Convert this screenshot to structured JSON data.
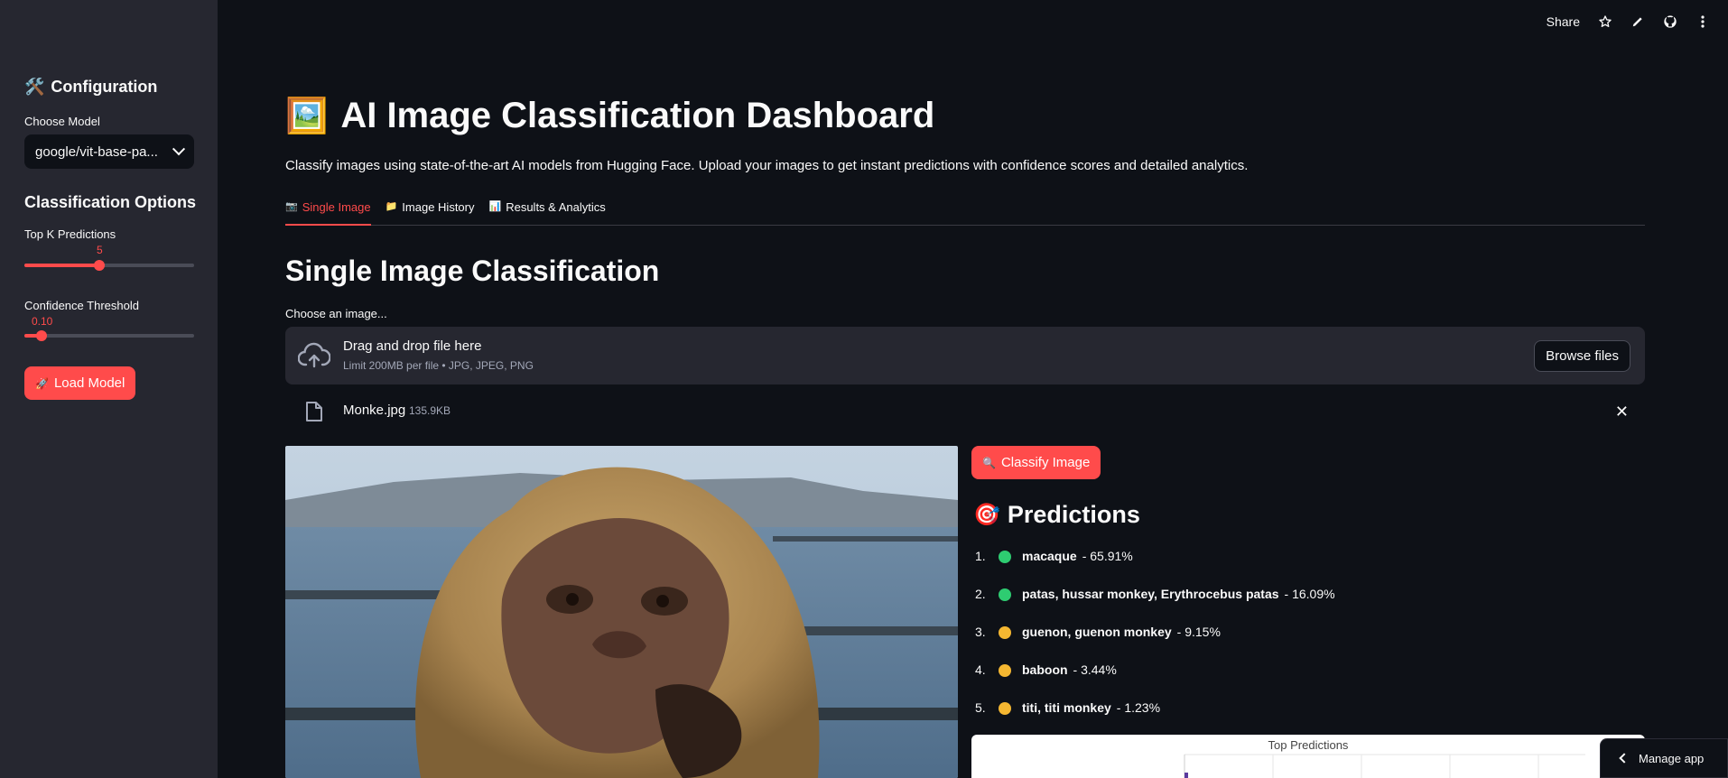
{
  "sidebar": {
    "config_title": "Configuration",
    "config_icon": "🛠️",
    "model_label": "Choose Model",
    "model_value": "google/vit-base-pa...",
    "options_title": "Classification Options",
    "topk_label": "Top K Predictions",
    "topk_value": "5",
    "topk_fraction": 0.44,
    "threshold_label": "Confidence Threshold",
    "threshold_value": "0.10",
    "threshold_fraction": 0.1,
    "load_button": "Load Model",
    "load_icon": "🚀"
  },
  "toolbar": {
    "share": "Share",
    "icons": [
      "star-icon",
      "edit-icon",
      "github-icon",
      "more-icon"
    ]
  },
  "header": {
    "icon": "🖼️",
    "title": "AI Image Classification Dashboard",
    "subtitle": "Classify images using state-of-the-art AI models from Hugging Face. Upload your images to get instant predictions with confidence scores and detailed analytics."
  },
  "tabs": [
    {
      "icon": "📷",
      "label": "Single Image",
      "active": true
    },
    {
      "icon": "📁",
      "label": "Image History",
      "active": false
    },
    {
      "icon": "📊",
      "label": "Results & Analytics",
      "active": false
    }
  ],
  "main": {
    "section_title": "Single Image Classification",
    "uploader_label": "Choose an image...",
    "dropzone_main": "Drag and drop file here",
    "dropzone_sub": "Limit 200MB per file • JPG, JPEG, PNG",
    "browse_label": "Browse files",
    "file_name": "Monke.jpg",
    "file_size": "135.9KB"
  },
  "classify": {
    "label": "Classify Image",
    "icon": "🔍"
  },
  "predictions": {
    "title": "Predictions",
    "icon": "🎯",
    "items": [
      {
        "num": "1.",
        "label": "macaque",
        "pct": "- 65.91%",
        "color": "#2ecc71"
      },
      {
        "num": "2.",
        "label": "patas, hussar monkey, Erythrocebus patas",
        "pct": "- 16.09%",
        "color": "#2ecc71"
      },
      {
        "num": "3.",
        "label": "guenon, guenon monkey",
        "pct": "- 9.15%",
        "color": "#f5b731"
      },
      {
        "num": "4.",
        "label": "baboon",
        "pct": "- 3.44%",
        "color": "#f5b731"
      },
      {
        "num": "5.",
        "label": "titi, titi monkey",
        "pct": "- 1.23%",
        "color": "#f5b731"
      }
    ]
  },
  "chart": {
    "title": "Top Predictions"
  },
  "manage_app": "Manage app",
  "colors": {
    "accent": "#ff4b4b",
    "bg": "#0e1117",
    "sidebar": "#262730"
  }
}
